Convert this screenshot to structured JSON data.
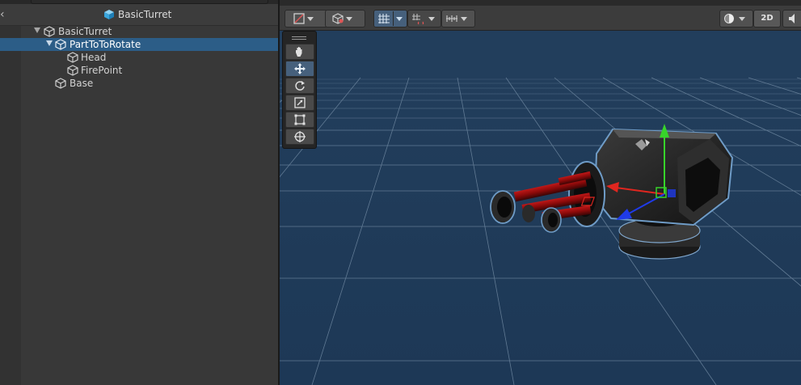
{
  "hierarchy": {
    "title": "BasicTurret",
    "back_glyph": "‹",
    "items": [
      {
        "label": "BasicTurret",
        "icon": "cube-icon",
        "expanded": true,
        "selected": false
      },
      {
        "label": "PartToToRotate",
        "icon": "cube-icon",
        "expanded": true,
        "selected": true
      },
      {
        "label": "Head",
        "icon": "cube-icon",
        "selected": false
      },
      {
        "label": "FirePoint",
        "icon": "cube-icon",
        "selected": false
      },
      {
        "label": "Base",
        "icon": "cube-icon",
        "selected": false
      }
    ]
  },
  "scene": {
    "toolbar": {
      "two_d_label": "2D",
      "buttons": [
        "draw-mode-icon",
        "shading-cube-icon",
        "grid-snap-icon",
        "increment-snap-icon",
        "ruler-icon",
        "lighting-icon",
        "2d-toggle",
        "audio-icon"
      ]
    },
    "tools": [
      "hand-tool",
      "move-tool",
      "rotate-tool",
      "scale-tool",
      "rect-tool",
      "transform-tool"
    ],
    "active_tool": "move-tool",
    "colors": {
      "background": "#1f3a58",
      "grid_line": "#6c859e",
      "selection_outline": "#6f9cc7",
      "selected_row": "#2c5d87",
      "axis_x": "#e0261f",
      "axis_y": "#37d42a",
      "axis_z": "#1f3be8"
    }
  }
}
